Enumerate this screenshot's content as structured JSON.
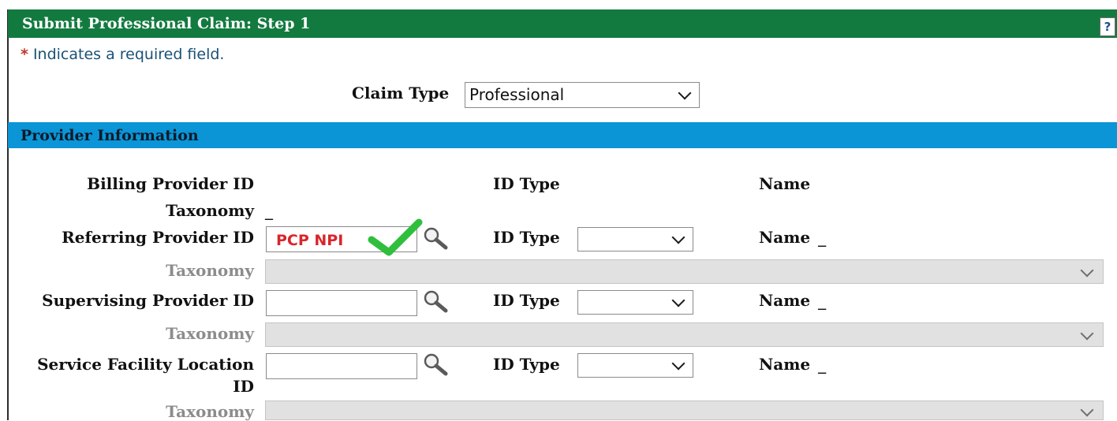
{
  "window": {
    "title": "Submit Professional Claim: Step 1",
    "help_icon": "?"
  },
  "required_note": {
    "star": "*",
    "text": "Indicates a required field."
  },
  "claim_type": {
    "label": "Claim Type",
    "selected": "Professional"
  },
  "provider_section": {
    "title": "Provider Information"
  },
  "billing": {
    "label": "Billing Provider ID",
    "id_type_label": "ID Type",
    "name_label": "Name",
    "taxonomy_label": "Taxonomy",
    "taxonomy_value": "_"
  },
  "referring": {
    "label": "Referring Provider ID",
    "annotation": "PCP NPI",
    "id_type_label": "ID Type",
    "name_label": "Name",
    "name_value": "_",
    "taxonomy_label": "Taxonomy"
  },
  "supervising": {
    "label": "Supervising Provider ID",
    "id_type_label": "ID Type",
    "name_label": "Name",
    "name_value": "_",
    "taxonomy_label": "Taxonomy"
  },
  "service_facility": {
    "label_line1": "Service Facility Location",
    "label_line2": "ID",
    "id_type_label": "ID Type",
    "name_label": "Name",
    "name_value": "_",
    "taxonomy_label": "Taxonomy"
  },
  "colors": {
    "title_bar": "#137a3f",
    "section_bar": "#0b95d6",
    "annotation_red": "#d9262b",
    "check_green": "#2fbf3d"
  },
  "icons": {
    "help": "question-icon",
    "lookup": "magnifier-icon",
    "annotation": "checkmark-icon",
    "dropdown": "chevron-down-icon"
  }
}
